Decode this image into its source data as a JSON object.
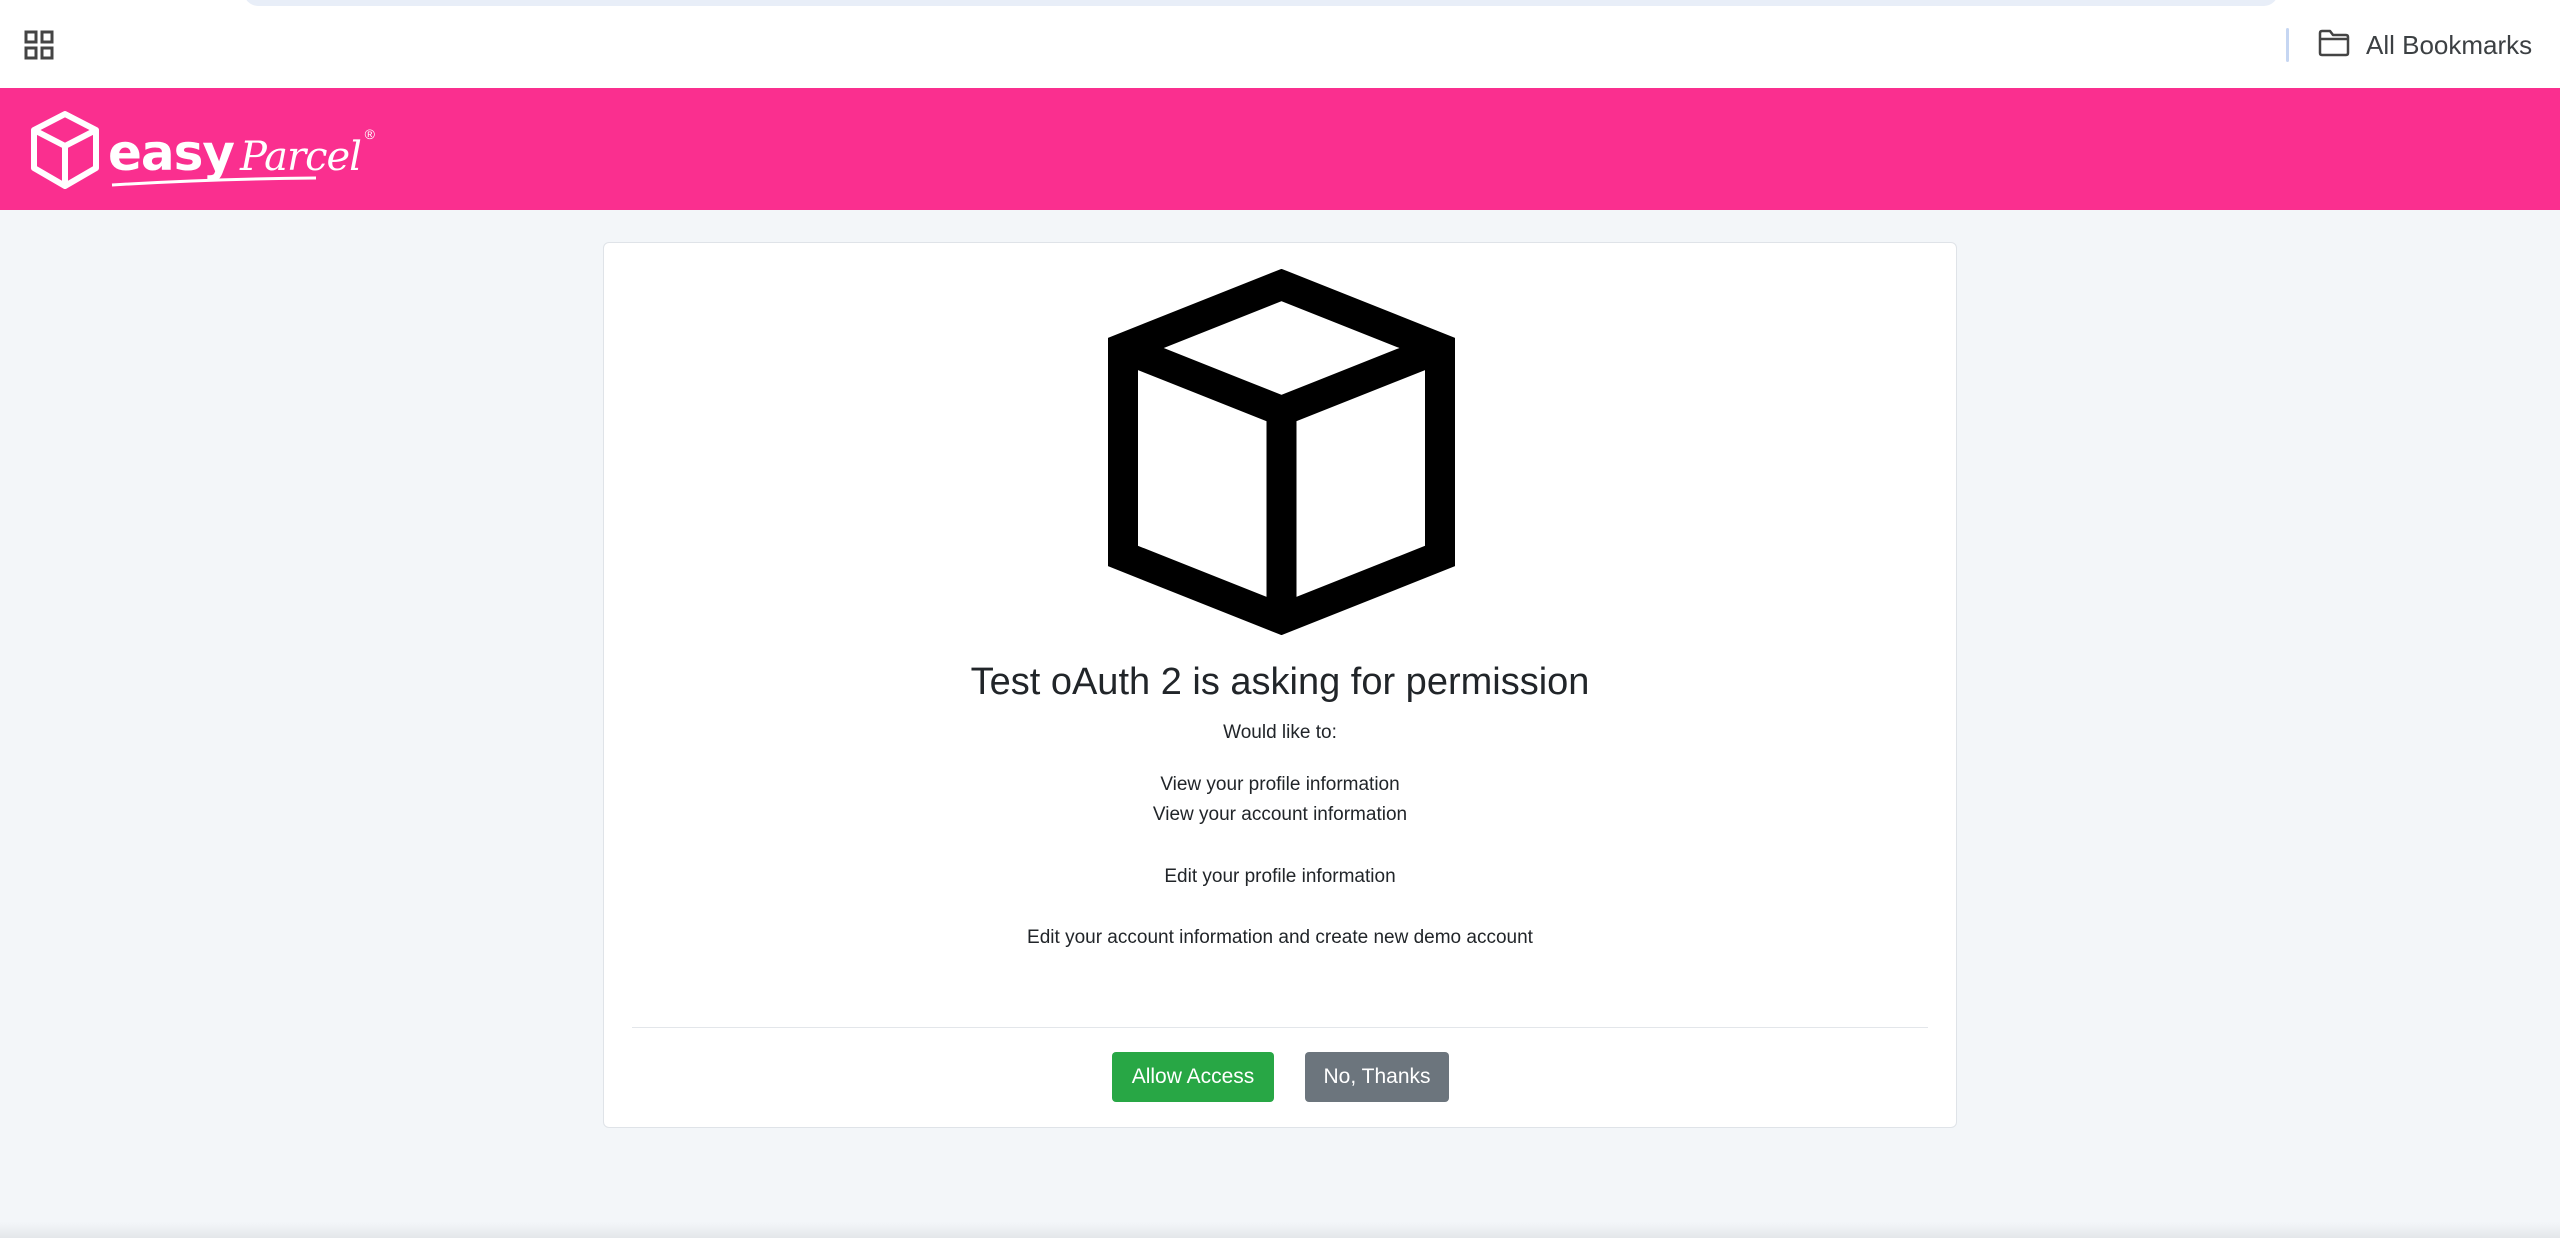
{
  "browser": {
    "bookmarks_label": "All Bookmarks"
  },
  "brand": {
    "name_primary": "easy",
    "name_secondary": "Parcel",
    "registered_mark": "®",
    "header_color": "#fa2f8f"
  },
  "consent": {
    "title": "Test oAuth 2 is asking for permission",
    "subtitle": "Would like to:",
    "permissions": [
      "View your profile information",
      "View your account information",
      "Edit your profile information",
      "Edit your account information and create new demo account"
    ],
    "allow_label": "Allow Access",
    "deny_label": "No, Thanks",
    "allow_color": "#28a745",
    "deny_color": "#6c757d"
  }
}
